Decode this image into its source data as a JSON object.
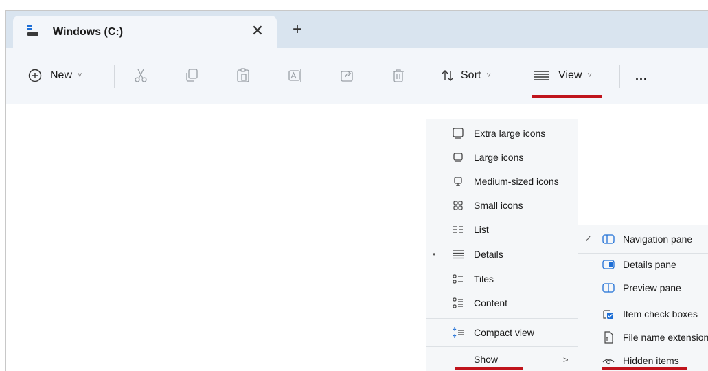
{
  "tab": {
    "title": "Windows (C:)",
    "close": "✕",
    "new_tab": "+"
  },
  "toolbar": {
    "new_label": "New",
    "sort_label": "Sort",
    "view_label": "View",
    "more_label": "...",
    "chevron": "˅"
  },
  "view_menu": {
    "items": [
      {
        "label": "Extra large icons",
        "icon": "monitor-icon"
      },
      {
        "label": "Large icons",
        "icon": "monitor-icon"
      },
      {
        "label": "Medium-sized icons",
        "icon": "monitor-icon"
      },
      {
        "label": "Small icons",
        "icon": "grid-icon"
      },
      {
        "label": "List",
        "icon": "list-icon"
      },
      {
        "label": "Details",
        "icon": "details-icon",
        "selected": true
      },
      {
        "label": "Tiles",
        "icon": "tiles-icon"
      },
      {
        "label": "Content",
        "icon": "content-icon"
      },
      {
        "label": "Compact view",
        "icon": "compact-icon"
      },
      {
        "label": "Show",
        "submenu_arrow": ">"
      }
    ],
    "bullet": "•"
  },
  "show_menu": {
    "items": [
      {
        "label": "Navigation pane",
        "checked": true,
        "icon": "pane-icon"
      },
      {
        "label": "Details pane",
        "icon": "details-pane-icon"
      },
      {
        "label": "Preview pane",
        "icon": "preview-pane-icon"
      },
      {
        "label": "Item check boxes",
        "icon": "checkbox-icon"
      },
      {
        "label": "File name extensions",
        "icon": "file-icon"
      },
      {
        "label": "Hidden items",
        "icon": "eye-icon"
      }
    ],
    "check": "✓"
  },
  "colors": {
    "accent_underline": "#c0141c",
    "tabstrip": "#d9e4ef",
    "toolbar": "#f3f6fa",
    "menu_bg": "#f5f7f9"
  }
}
